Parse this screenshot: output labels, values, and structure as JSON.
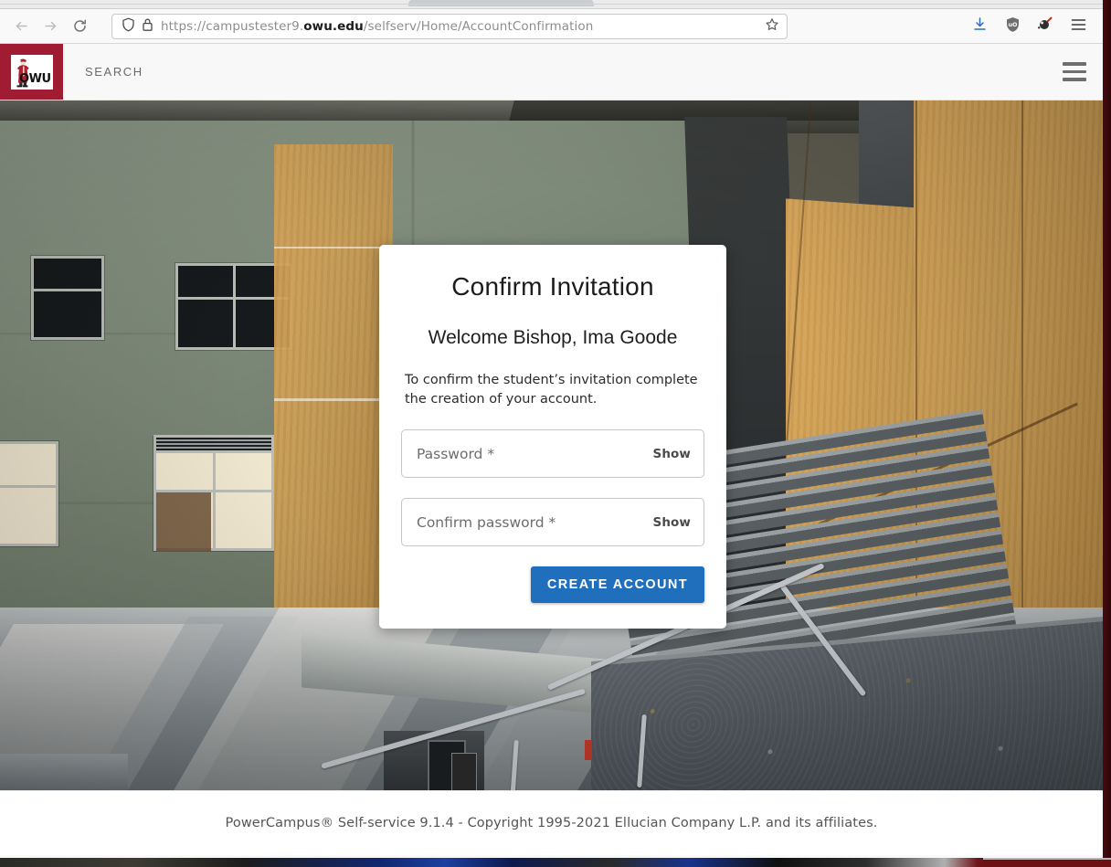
{
  "browser": {
    "back_icon": "back-arrow-icon",
    "forward_icon": "forward-arrow-icon",
    "reload_icon": "reload-icon",
    "shield_icon": "shield-icon",
    "lock_icon": "padlock-icon",
    "bookmark_icon": "star-icon",
    "url_prefix": "https://campustester9.",
    "url_host": "owu.edu",
    "url_suffix": "/selfserv/Home/AccountConfirmation",
    "toolbar_icons": [
      {
        "name": "downloads-icon",
        "label": "Downloads"
      },
      {
        "name": "ublock-shield-icon",
        "label": "uBlock Origin"
      },
      {
        "name": "adblock-icon",
        "label": "Ad blocker"
      },
      {
        "name": "menu-hamburger-icon",
        "label": "Open application menu"
      }
    ]
  },
  "site_header": {
    "logo_alt": "OWU Battling Bishop logo",
    "logo_text": "OWU",
    "search_label": "SEARCH",
    "menu_icon": "hamburger-menu-icon"
  },
  "card": {
    "title": "Confirm Invitation",
    "welcome": "Welcome Bishop, Ima Goode",
    "description": "To confirm the student’s invitation complete the creation of your account.",
    "password": {
      "placeholder": "Password *",
      "value": "",
      "show_label": "Show"
    },
    "confirm_password": {
      "placeholder": "Confirm password *",
      "value": "",
      "show_label": "Show"
    },
    "submit_label": "CREATE ACCOUNT"
  },
  "footer": {
    "text": "PowerCampus® Self-service 9.1.4 - Copyright 1995-2021 Ellucian Company L.P. and its affiliates."
  },
  "colors": {
    "brand_red": "#a01c33",
    "primary_button": "#1f6fbd",
    "header_bg": "#f8f8f8"
  }
}
